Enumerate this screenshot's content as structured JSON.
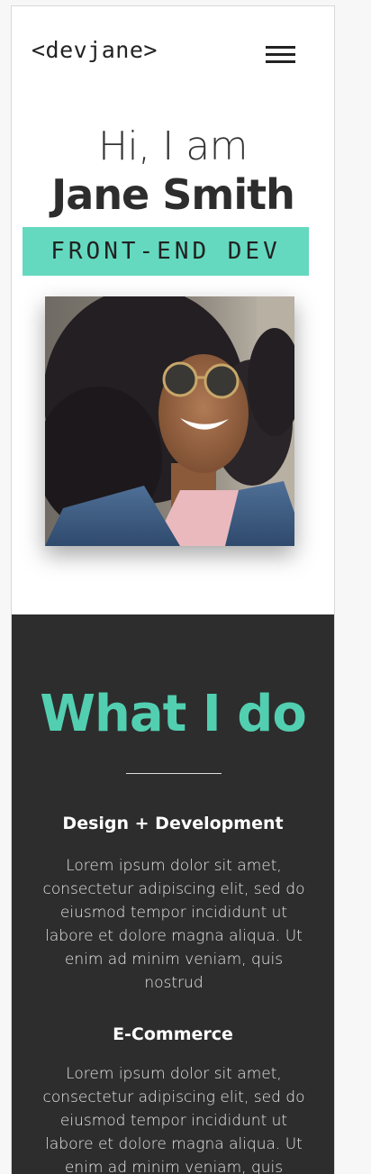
{
  "header": {
    "logo_text": "<devjane>"
  },
  "hero": {
    "greeting": "Hi, I am",
    "name": "Jane Smith",
    "role": "FRONT-END DEV"
  },
  "services": {
    "title": "What I do",
    "items": [
      {
        "title": "Design + Development",
        "description": "Lorem ipsum dolor sit amet, consectetur adipiscing elit, sed do eiusmod tempor incididunt ut labore et dolore magna aliqua. Ut enim ad minim veniam, quis nostrud"
      },
      {
        "title": "E-Commerce",
        "description": "Lorem ipsum dolor sit amet, consectetur adipiscing elit, sed do eiusmod tempor incididunt ut labore et dolore magna aliqua. Ut enim ad minim veniam, quis nostrud"
      }
    ]
  },
  "colors": {
    "accent": "#64d9bf",
    "dark_bg": "#2d2d2d",
    "accent_text": "#52cfb0"
  }
}
